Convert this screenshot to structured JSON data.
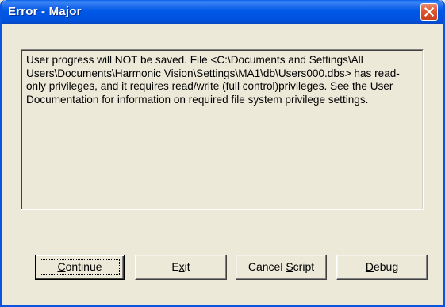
{
  "window": {
    "title": "Error - Major",
    "close_icon": "close-x-icon",
    "close_color": "#E0572F",
    "titlebar_color": "#0054E3"
  },
  "message": {
    "text": "User progress will NOT be saved. File <C:\\Documents and Settings\\All Users\\Documents\\Harmonic Vision\\Settings\\MA1\\db\\Users000.dbs> has read-only privileges, and it requires read/write (full control)privileges. See the User Documentation for information on required file system privilege settings."
  },
  "buttons": {
    "continue": {
      "pre": "",
      "accel": "C",
      "post": "ontinue"
    },
    "exit": {
      "pre": "E",
      "accel": "x",
      "post": "it"
    },
    "cancel_script": {
      "pre": "Cancel ",
      "accel": "S",
      "post": "cript"
    },
    "debug": {
      "pre": "",
      "accel": "D",
      "post": "ebug"
    }
  }
}
